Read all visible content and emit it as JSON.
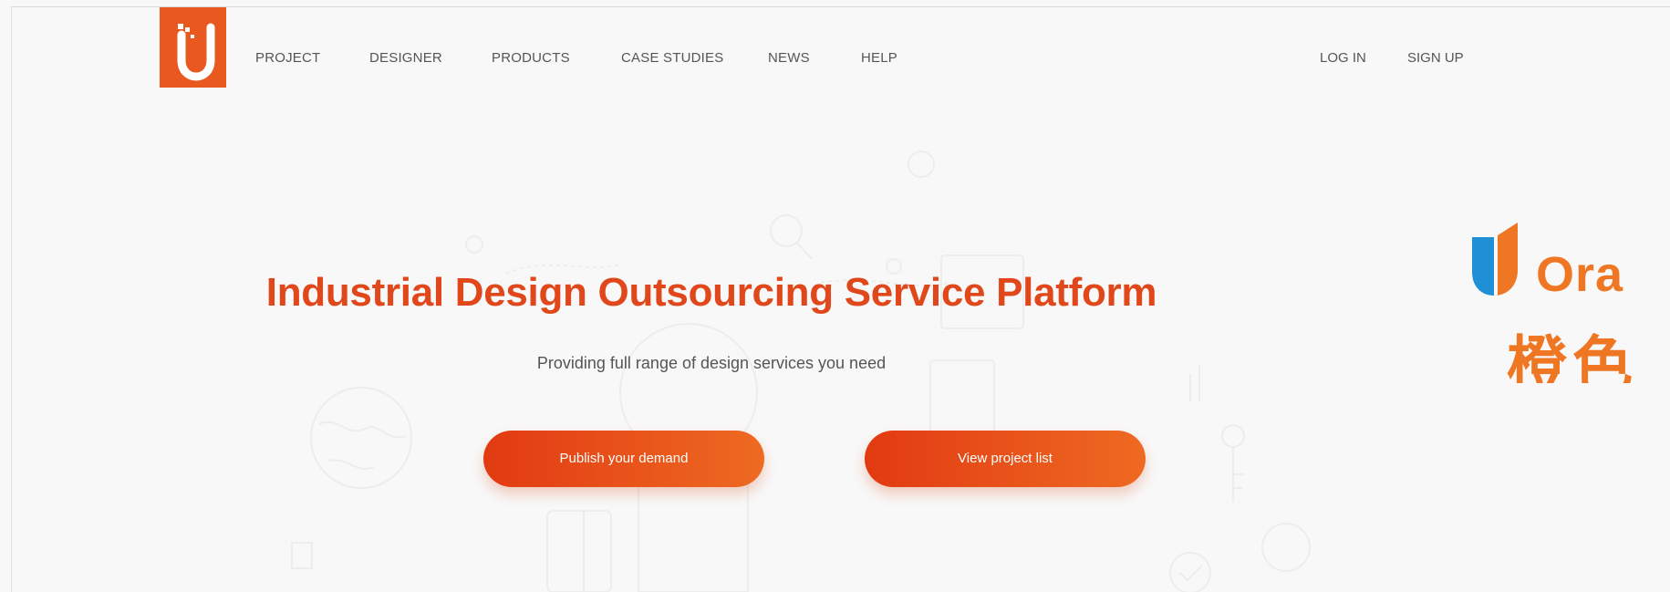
{
  "header": {
    "nav_items": [
      "PROJECT",
      "DESIGNER",
      "PRODUCTS",
      "CASE STUDIES",
      "NEWS",
      "HELP"
    ],
    "login_label": "LOG IN",
    "signup_label": "SIGN UP"
  },
  "hero": {
    "title": "Industrial Design Outsourcing Service Platform",
    "subtitle": "Providing full range of design services you need",
    "publish_button": "Publish your demand",
    "projects_button": "View project list"
  },
  "brand": {
    "name_visible": "Ora",
    "chinese_visible": "橙色"
  },
  "colors": {
    "accent": "#e0481b",
    "logo_bg": "#e8581f",
    "brand_orange": "#ef7622",
    "brand_blue": "#1f8fd6"
  }
}
